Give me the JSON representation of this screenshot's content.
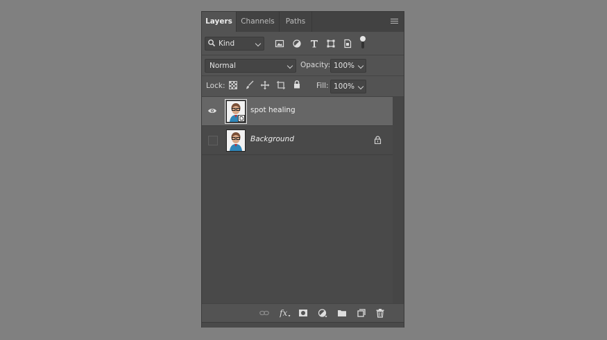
{
  "tabs": [
    {
      "label": "Layers",
      "active": true
    },
    {
      "label": "Channels",
      "active": false
    },
    {
      "label": "Paths",
      "active": false
    }
  ],
  "filter": {
    "kind_label": "Kind",
    "icons": [
      "search-icon",
      "pixel-filter-icon",
      "adjustment-filter-icon",
      "type-filter-icon",
      "shape-filter-icon",
      "smart-object-filter-icon",
      "filter-toggle-icon"
    ]
  },
  "blend": {
    "mode": "Normal",
    "opacity_label": "Opacity:",
    "opacity_value": "100%"
  },
  "lock": {
    "label": "Lock:",
    "icons": [
      "lock-transparent-icon",
      "lock-image-icon",
      "lock-position-icon",
      "lock-artboard-icon",
      "lock-all-icon"
    ],
    "fill_label": "Fill:",
    "fill_value": "100%"
  },
  "layers": [
    {
      "name": "spot healing",
      "visible": true,
      "selected": true,
      "locked": false,
      "smart_object": true
    },
    {
      "name": "Background",
      "visible": false,
      "selected": false,
      "locked": true,
      "italic": true
    }
  ],
  "bottom_icons": [
    "link-layers-icon",
    "layer-style-icon",
    "add-mask-icon",
    "adjustment-layer-icon",
    "new-group-icon",
    "new-layer-icon",
    "delete-layer-icon"
  ],
  "colors": {
    "background": "#808080",
    "panel": "#535353",
    "tabbar": "#424242",
    "selected_layer": "#666666"
  }
}
